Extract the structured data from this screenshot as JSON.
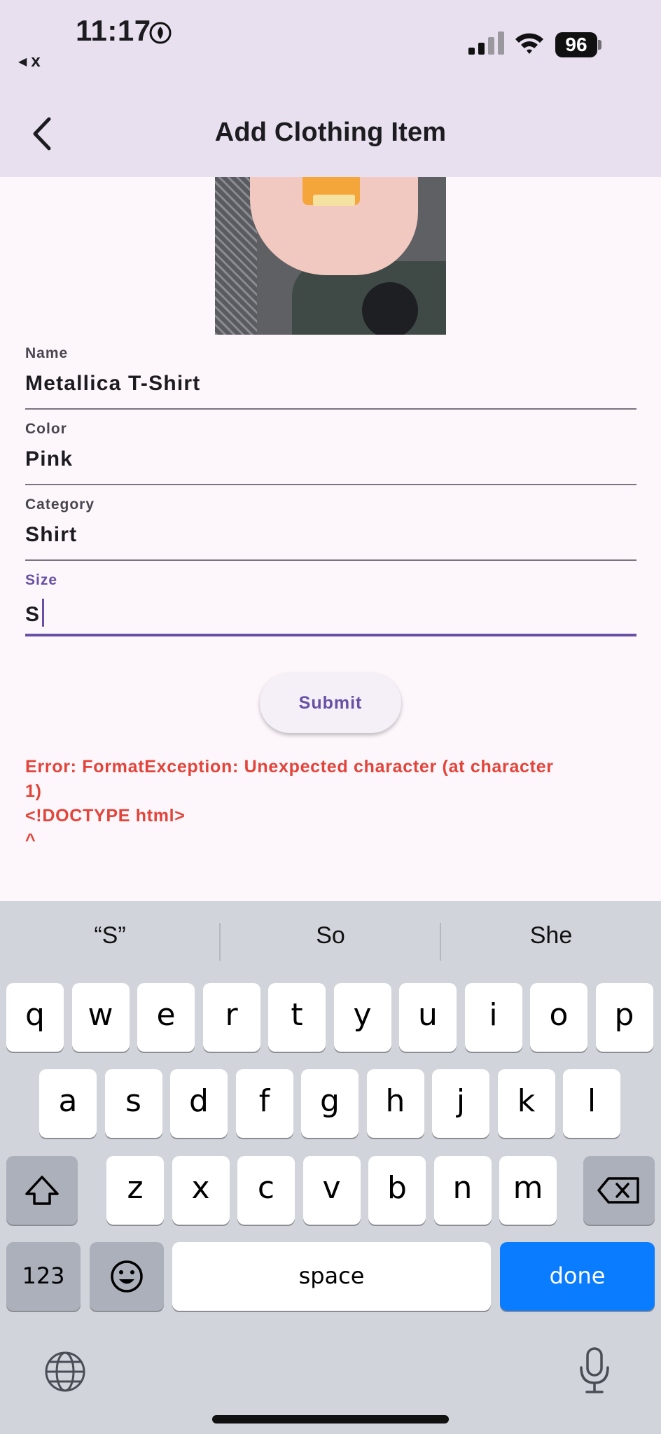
{
  "status_bar": {
    "time": "11:17",
    "back_app": "x",
    "battery": "96"
  },
  "nav": {
    "title": "Add Clothing Item"
  },
  "form": {
    "fields": [
      {
        "label": "Name",
        "value": "Metallica T-Shirt"
      },
      {
        "label": "Color",
        "value": "Pink"
      },
      {
        "label": "Category",
        "value": "Shirt"
      },
      {
        "label": "Size",
        "value": "S"
      }
    ],
    "submit_label": "Submit"
  },
  "error_text": "Error: FormatException: Unexpected character (at character\n1)\n<!DOCTYPE html>\n^",
  "keyboard": {
    "suggestions": [
      "“S”",
      "So",
      "She"
    ],
    "row1": [
      "q",
      "w",
      "e",
      "r",
      "t",
      "y",
      "u",
      "i",
      "o",
      "p"
    ],
    "row2": [
      "a",
      "s",
      "d",
      "f",
      "g",
      "h",
      "j",
      "k",
      "l"
    ],
    "row3": [
      "z",
      "x",
      "c",
      "v",
      "b",
      "n",
      "m"
    ],
    "numbers_label": "123",
    "space_label": "space",
    "done_label": "done"
  },
  "colors": {
    "accent": "#6750a4",
    "error": "#e2443a",
    "done_key": "#0a7cff"
  }
}
